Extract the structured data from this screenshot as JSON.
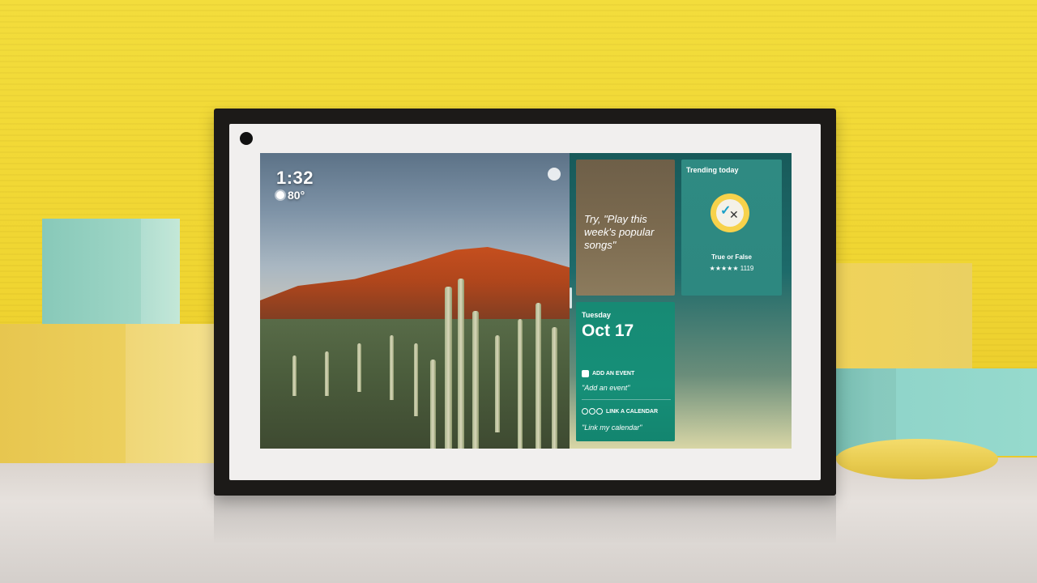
{
  "device": {
    "screen": {
      "clock": "1:32",
      "weather": {
        "icon": "sun-icon",
        "temperature": "80°"
      },
      "widgets": {
        "try_tile": {
          "text": "Try, \"Play this week's popular songs\""
        },
        "trending_tile": {
          "title": "Trending today",
          "app_icon": "true-or-false-icon",
          "app_name": "True or False",
          "rating_stars": "★★★★★",
          "rating_count": "1119"
        },
        "calendar_tile": {
          "day": "Tuesday",
          "date": "Oct 17",
          "add_event_label": "ADD AN EVENT",
          "add_event_hint": "\"Add an event\"",
          "link_calendar_label": "LINK A CALENDAR",
          "link_calendar_hint": "\"Link my calendar\""
        }
      }
    }
  },
  "colors": {
    "wall": "#f0d531",
    "panel_top": "#185a5a",
    "calendar_tile": "#168f78",
    "trending_tile": "#2d8880",
    "try_tile": "#7b6a4f"
  }
}
